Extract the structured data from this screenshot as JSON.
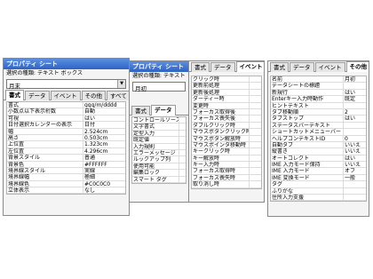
{
  "panel1": {
    "title": "プロパティ シート",
    "subtitle": "選択の種類: テキスト ボックス",
    "combo_value": "月末",
    "tabs": [
      "書式",
      "データ",
      "イベント",
      "その他",
      "すべて"
    ],
    "rows": [
      {
        "k": "書式",
        "v": "ggg/m/dddd"
      },
      {
        "k": "小数点以下表示桁数",
        "v": "自動"
      },
      {
        "k": "可視",
        "v": "はい"
      },
      {
        "k": "日付選択カレンダーの表示",
        "v": "日付"
      },
      {
        "k": "幅",
        "v": "2.524cm"
      },
      {
        "k": "高さ",
        "v": "0.503cm"
      },
      {
        "k": "上位置",
        "v": "1.323cm"
      },
      {
        "k": "左位置",
        "v": "4.296cm"
      },
      {
        "k": "背景スタイル",
        "v": "普通"
      },
      {
        "k": "背景色",
        "v": "#FFFFFF"
      },
      {
        "k": "境界線スタイル",
        "v": "実線"
      },
      {
        "k": "境界線幅",
        "v": "極細"
      },
      {
        "k": "境界線色",
        "v": "#C0C0C0"
      },
      {
        "k": "立体表示",
        "v": "なし"
      }
    ]
  },
  "panel2": {
    "title": "プロパティ シート",
    "subtitle": "選択の種類: テキスト",
    "combo_value": "月初",
    "tabs": [
      "書式",
      "データ"
    ],
    "rows": [
      {
        "k": "コントロールソース",
        "v": ""
      },
      {
        "k": "文字書式",
        "v": ""
      },
      {
        "k": "定型入力",
        "v": ""
      },
      {
        "k": "既定値",
        "v": ""
      },
      {
        "k": "入力規則",
        "v": ""
      },
      {
        "k": "エラーメッセージ",
        "v": ""
      },
      {
        "k": "ルックアップ列",
        "v": ""
      },
      {
        "k": "使用可能",
        "v": ""
      },
      {
        "k": "編集ロック",
        "v": ""
      },
      {
        "k": "スマート タグ",
        "v": ""
      }
    ]
  },
  "panel3": {
    "tabs": [
      "書式",
      "データ",
      "イベント"
    ],
    "rows": [
      {
        "k": "クリック時",
        "v": ""
      },
      {
        "k": "更新前処理",
        "v": ""
      },
      {
        "k": "更新後処理",
        "v": ""
      },
      {
        "k": "ダーティー時",
        "v": ""
      },
      {
        "k": "変更時",
        "v": ""
      },
      {
        "k": "フォーカス取得後",
        "v": ""
      },
      {
        "k": "フォーカス喪失後",
        "v": ""
      },
      {
        "k": "ダブルクリック時",
        "v": ""
      },
      {
        "k": "マウスボタンクリック時",
        "v": ""
      },
      {
        "k": "マウスボタン解放時",
        "v": ""
      },
      {
        "k": "マウスポインタ移動時",
        "v": ""
      },
      {
        "k": "キークリック時",
        "v": ""
      },
      {
        "k": "キー解放時",
        "v": ""
      },
      {
        "k": "キー入力時",
        "v": ""
      },
      {
        "k": "フォーカス取得時",
        "v": ""
      },
      {
        "k": "フォーカス喪失時",
        "v": ""
      },
      {
        "k": "取り消し時",
        "v": ""
      }
    ]
  },
  "panel4": {
    "tabs": [
      "書式",
      "データ",
      "イベント",
      "その他"
    ],
    "rows": [
      {
        "k": "名前",
        "v": "月初"
      },
      {
        "k": "データシートの標題",
        "v": ""
      },
      {
        "k": "新規行",
        "v": "はい"
      },
      {
        "k": "Enterキー入力時動作",
        "v": "既定"
      },
      {
        "k": "ヒントテキスト",
        "v": ""
      },
      {
        "k": "タブ移動順",
        "v": "2"
      },
      {
        "k": "タブストップ",
        "v": "はい"
      },
      {
        "k": "ステータスバーテキスト",
        "v": ""
      },
      {
        "k": "ショートカットメニューバー",
        "v": ""
      },
      {
        "k": "ヘルプコンテキストID",
        "v": "0"
      },
      {
        "k": "自動タブ",
        "v": "いいえ"
      },
      {
        "k": "縦書き",
        "v": "いいえ"
      },
      {
        "k": "オートコレクト",
        "v": "はい"
      },
      {
        "k": "IME 入力モード保持",
        "v": "いいえ"
      },
      {
        "k": "IME 入力モード",
        "v": "オフ"
      },
      {
        "k": "IME 変換モード",
        "v": "一般"
      },
      {
        "k": "タグ",
        "v": ""
      },
      {
        "k": "ふりがな",
        "v": ""
      },
      {
        "k": "住所入力支援",
        "v": ""
      }
    ]
  }
}
